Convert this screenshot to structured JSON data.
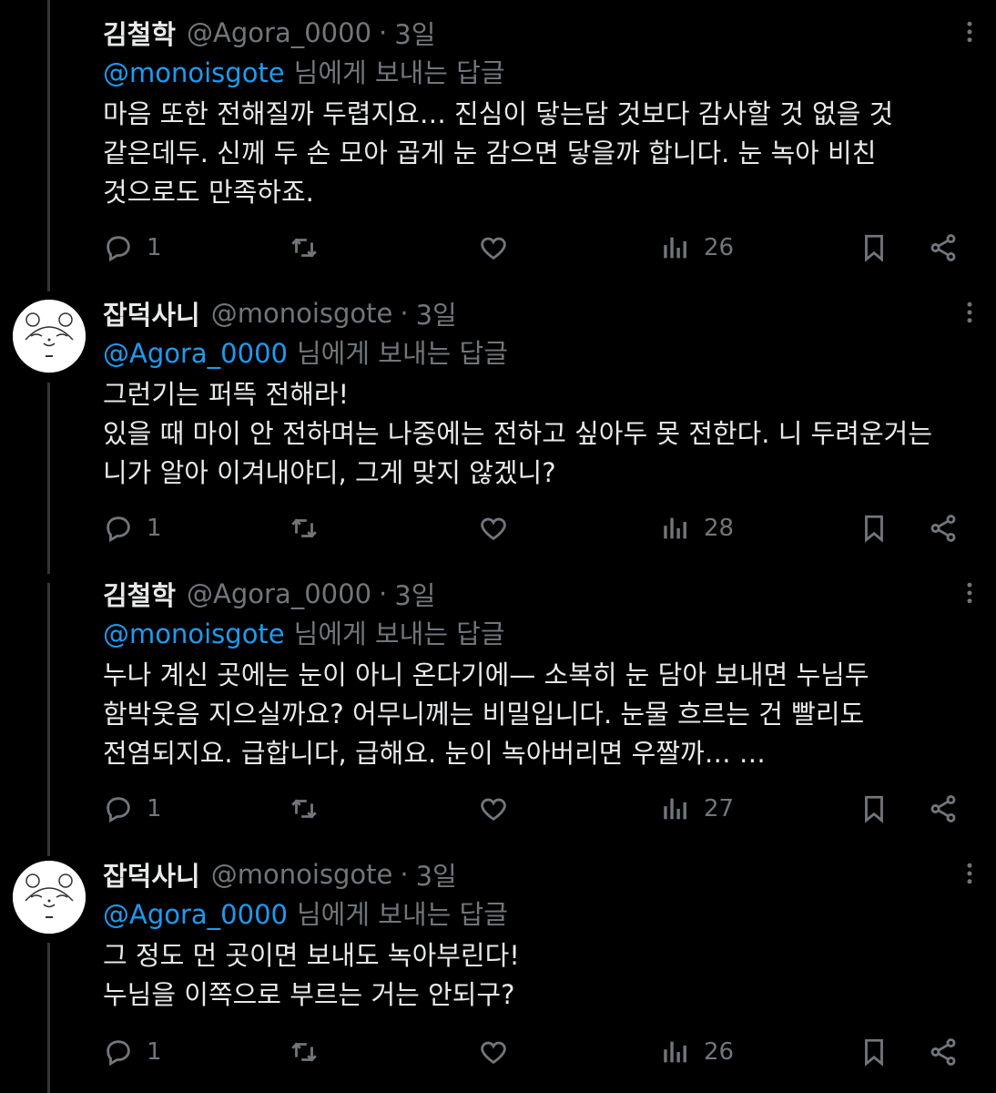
{
  "replying_suffix": "님에게 보내는 답글",
  "tweets": [
    {
      "name": "김철학",
      "handle": "@Agora_0000",
      "time": "3일",
      "reply_to": "@monoisgote",
      "lines": [
        "마음 또한 전해질까 두렵지요… 진심이 닿는담 것보다 감사할 것 없을 것",
        "같은데두. 신께 두 손 모아 곱게 눈 감으면 닿을까 합니다. 눈 녹아 비친",
        "것으로도 만족하죠."
      ],
      "replies": "1",
      "retweets": "",
      "likes": "",
      "views": "26"
    },
    {
      "name": "잡덕사니",
      "handle": "@monoisgote",
      "time": "3일",
      "reply_to": "@Agora_0000",
      "lines": [
        "그런기는 퍼뜩 전해라!",
        "있을 때 마이 안 전하며는 나중에는 전하고 싶아두 못 전한다. 니 두려운거는",
        "니가 알아 이겨내야디, 그게 맞지 않겠니?"
      ],
      "replies": "1",
      "retweets": "",
      "likes": "",
      "views": "28"
    },
    {
      "name": "김철학",
      "handle": "@Agora_0000",
      "time": "3일",
      "reply_to": "@monoisgote",
      "lines": [
        "누나 계신 곳에는 눈이 아니 온다기에— 소복히 눈 담아 보내면 누님두",
        "함박웃음 지으실까요? 어무니께는 비밀입니다. 눈물 흐르는 건 빨리도",
        "전염되지요. 급합니다, 급해요. 눈이 녹아버리면 우짤까… …"
      ],
      "replies": "1",
      "retweets": "",
      "likes": "",
      "views": "27"
    },
    {
      "name": "잡덕사니",
      "handle": "@monoisgote",
      "time": "3일",
      "reply_to": "@Agora_0000",
      "lines": [
        "그 정도 먼 곳이면 보내도 녹아부린다!",
        "누님을 이쪽으로 부르는 거는 안되구?"
      ],
      "replies": "1",
      "retweets": "",
      "likes": "",
      "views": "26"
    }
  ]
}
